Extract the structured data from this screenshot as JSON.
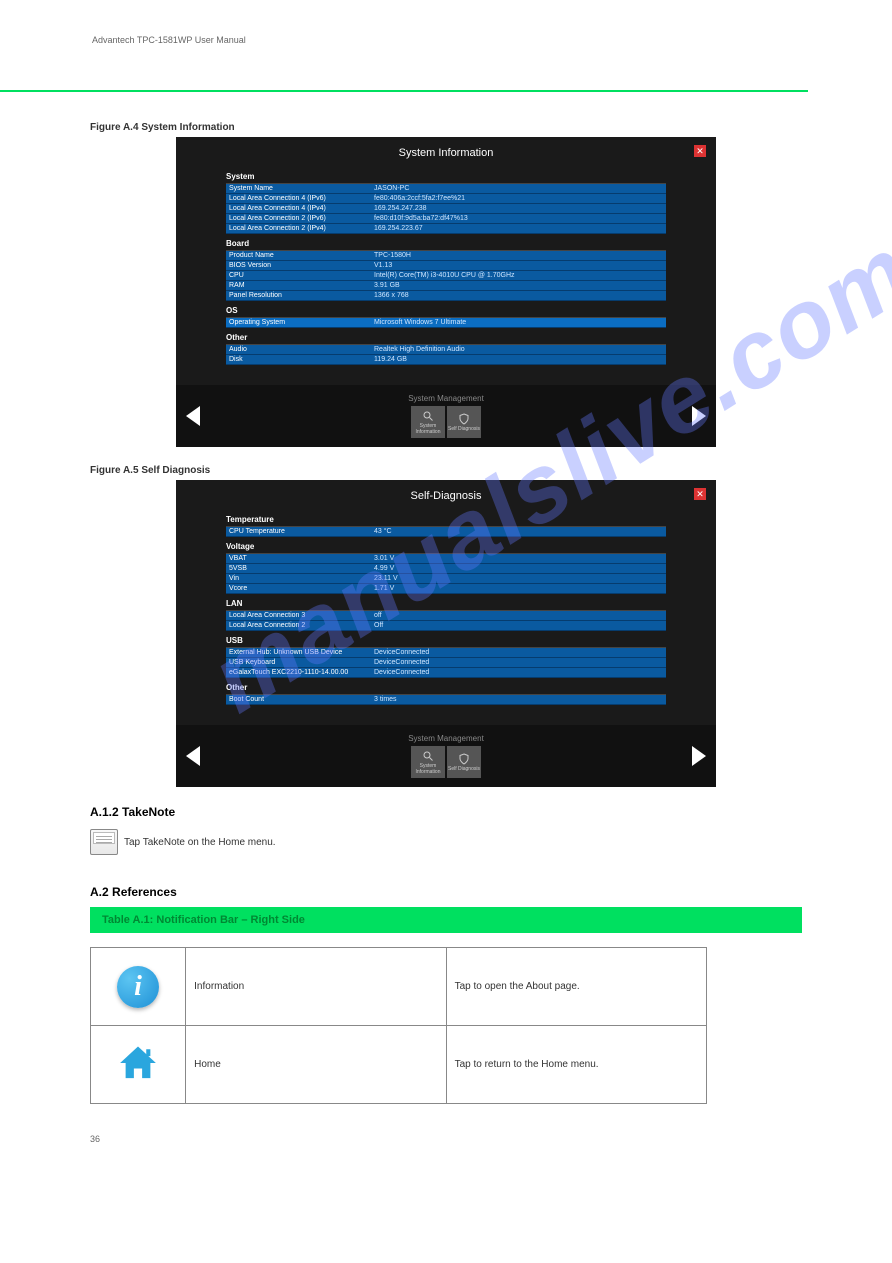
{
  "page_header": "Advantech TPC-1581WP User Manual",
  "watermark": "manualslive.com",
  "screenshot1": {
    "caption_prefix": "Figure A.4",
    "caption": "System Information",
    "title": "System Information",
    "sections": [
      {
        "header": "System",
        "rows": [
          {
            "k": "System Name",
            "v": "JASON-PC"
          },
          {
            "k": "Local Area Connection 4 (IPv6)",
            "v": "fe80:406a:2ccf:5fa2:f7ee%21"
          },
          {
            "k": "Local Area Connection 4 (IPv4)",
            "v": "169.254.247.238"
          },
          {
            "k": "Local Area Connection 2 (IPv6)",
            "v": "fe80:d10f:9d5a:ba72:df47%13"
          },
          {
            "k": "Local Area Connection 2 (IPv4)",
            "v": "169.254.223.67"
          }
        ]
      },
      {
        "header": "Board",
        "rows": [
          {
            "k": "Product Name",
            "v": "TPC-1580H"
          },
          {
            "k": "BIOS Version",
            "v": "V1.13"
          },
          {
            "k": "CPU",
            "v": "Intel(R) Core(TM) i3-4010U CPU @ 1.70GHz"
          },
          {
            "k": "RAM",
            "v": "3.91 GB"
          },
          {
            "k": "Panel Resolution",
            "v": "1366 x 768"
          }
        ]
      },
      {
        "header": "OS",
        "rows": [
          {
            "k": "Operating System",
            "v": "Microsoft Windows 7 Ultimate",
            "highlight": true
          }
        ]
      },
      {
        "header": "Other",
        "rows": [
          {
            "k": "Audio",
            "v": "Realtek High Definition Audio"
          },
          {
            "k": "Disk",
            "v": "119.24 GB"
          }
        ]
      }
    ],
    "footer_label": "System Management",
    "tiles": [
      {
        "name": "system-information-tile",
        "label": "System Information",
        "icon": "magnifier"
      },
      {
        "name": "self-diagnosis-tile",
        "label": "Self Diagnosis",
        "icon": "shield"
      }
    ]
  },
  "screenshot2": {
    "caption_prefix": "Figure A.5",
    "caption": "Self Diagnosis",
    "title": "Self-Diagnosis",
    "sections": [
      {
        "header": "Temperature",
        "rows": [
          {
            "k": "CPU Temperature",
            "v": "43 °C"
          }
        ]
      },
      {
        "header": "Voltage",
        "rows": [
          {
            "k": "VBAT",
            "v": "3.01 V"
          },
          {
            "k": "5VSB",
            "v": "4.99 V"
          },
          {
            "k": "Vin",
            "v": "23.11 V"
          },
          {
            "k": "Vcore",
            "v": "1.71 V"
          }
        ]
      },
      {
        "header": "LAN",
        "rows": [
          {
            "k": "Local Area Connection 3",
            "v": "off"
          },
          {
            "k": "Local Area Connection 2",
            "v": "Off"
          }
        ]
      },
      {
        "header": "USB",
        "rows": [
          {
            "k": "External Hub: Unknown USB Device",
            "v": "DeviceConnected"
          },
          {
            "k": "USB Keyboard",
            "v": "DeviceConnected"
          },
          {
            "k": "eGalaxTouch EXC2210-1110-14.00.00",
            "v": "DeviceConnected"
          }
        ]
      },
      {
        "header": "Other",
        "rows": [
          {
            "k": "Boot Count",
            "v": "3 times"
          }
        ]
      }
    ],
    "footer_label": "System Management",
    "tiles": [
      {
        "name": "system-information-tile",
        "label": "System Information",
        "icon": "magnifier"
      },
      {
        "name": "self-diagnosis-tile",
        "label": "Self Diagnosis",
        "icon": "shield"
      }
    ]
  },
  "takenote": {
    "heading": "A.1.2",
    "title": "TakeNote",
    "desc": "Tap TakeNote on the Home menu."
  },
  "refs_section": {
    "heading": "A.2",
    "title": "References",
    "bar": "Table A.1: Notification Bar – Right Side",
    "rows": [
      {
        "label": "Information",
        "desc": "Tap to open the About page.",
        "icon": "info"
      },
      {
        "label": "Home",
        "desc": "Tap to return to the Home menu.",
        "icon": "home"
      }
    ]
  },
  "page_number": "36"
}
